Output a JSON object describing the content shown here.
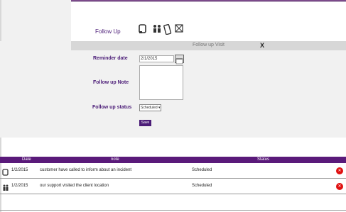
{
  "follow_up": {
    "label": "Follow Up",
    "icons": [
      "phone-icon",
      "people-icon",
      "mobile-icon",
      "email-icon"
    ]
  },
  "visit_panel": {
    "title": "Follow up Visit",
    "close_label": "X",
    "reminder_label": "Reminder date",
    "reminder_value": "2/1/2015",
    "note_label": "Follow up Note",
    "note_value": "",
    "status_label": "Follow up status",
    "status_value": "Scheduled",
    "save_label": "Save"
  },
  "table": {
    "columns": [
      "Date",
      "note",
      "Status"
    ],
    "rows": [
      {
        "icon": "phone-icon",
        "date": "1/2/2015",
        "note": "customer have called to inform about an incident",
        "status": "Scheduled"
      },
      {
        "icon": "people-icon",
        "date": "1/2/2015",
        "note": "our support visited the client location",
        "status": "Scheduled"
      }
    ]
  },
  "colors": {
    "accent": "#4b1c77",
    "header": "#5a1a7a",
    "delete": "#e01010"
  }
}
